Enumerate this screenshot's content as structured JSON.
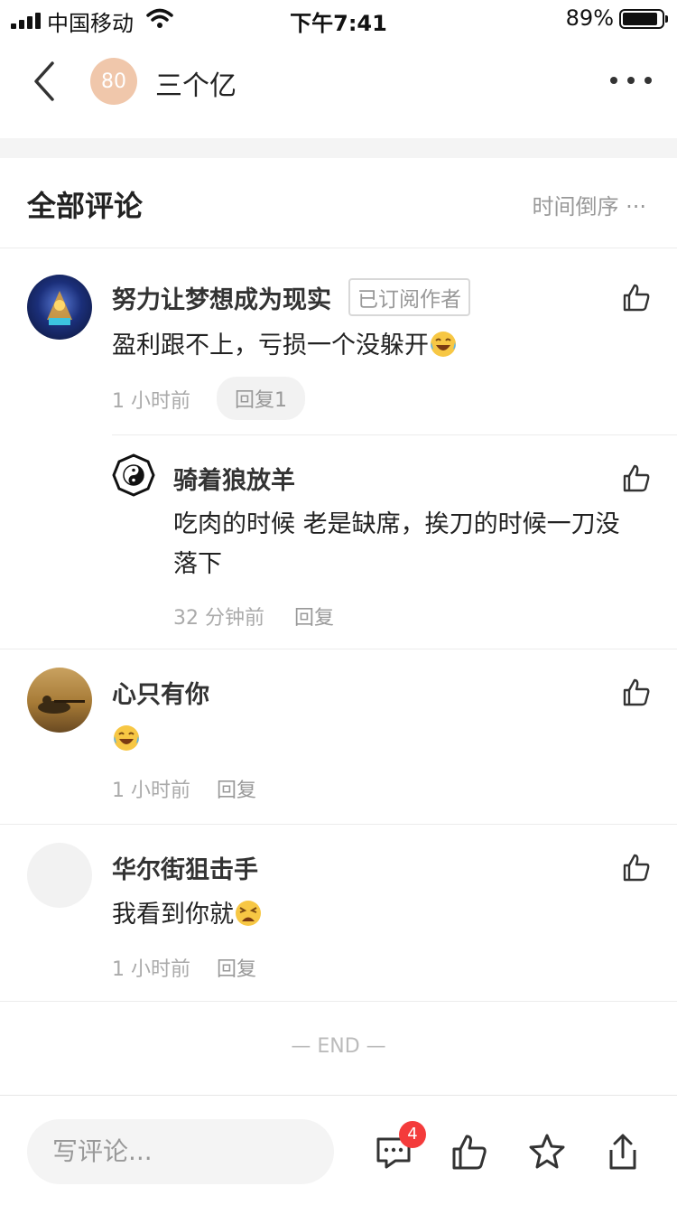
{
  "status_bar": {
    "carrier": "中国移动",
    "time": "下午7:41",
    "battery": "89%"
  },
  "nav": {
    "author_avatar_text": "80",
    "author_name": "三个亿",
    "avatar_color": "#f0c7ab"
  },
  "comments_header": {
    "title": "全部评论",
    "sort": "时间倒序 ···"
  },
  "comments": [
    {
      "user": "努力让梦想成为现实",
      "badge": "已订阅作者",
      "text": "盈利跟不上，亏损一个没躲开",
      "emoji": "laughing-tears",
      "time": "1 小时前",
      "reply": "回复1",
      "replies": [
        {
          "user": "骑着狼放羊",
          "text_line1": "吃肉的时候 老是缺席，挨刀的时候一刀没",
          "text_line2": "落下",
          "time": "32 分钟前",
          "reply": "回复"
        }
      ]
    },
    {
      "user": "心只有你",
      "text": "",
      "emoji": "laughing-tears",
      "time": "1 小时前",
      "reply": "回复"
    },
    {
      "user": "华尔街狙击手",
      "text": "我看到你就",
      "emoji": "weary-face",
      "time": "1 小时前",
      "reply": "回复"
    }
  ],
  "end_text": "— END —",
  "bottom_bar": {
    "input_placeholder": "写评论...",
    "comment_count": "4",
    "icons": [
      "comment-icon",
      "like-icon",
      "star-icon",
      "share-icon"
    ],
    "badge_color": "#f43b3b"
  }
}
